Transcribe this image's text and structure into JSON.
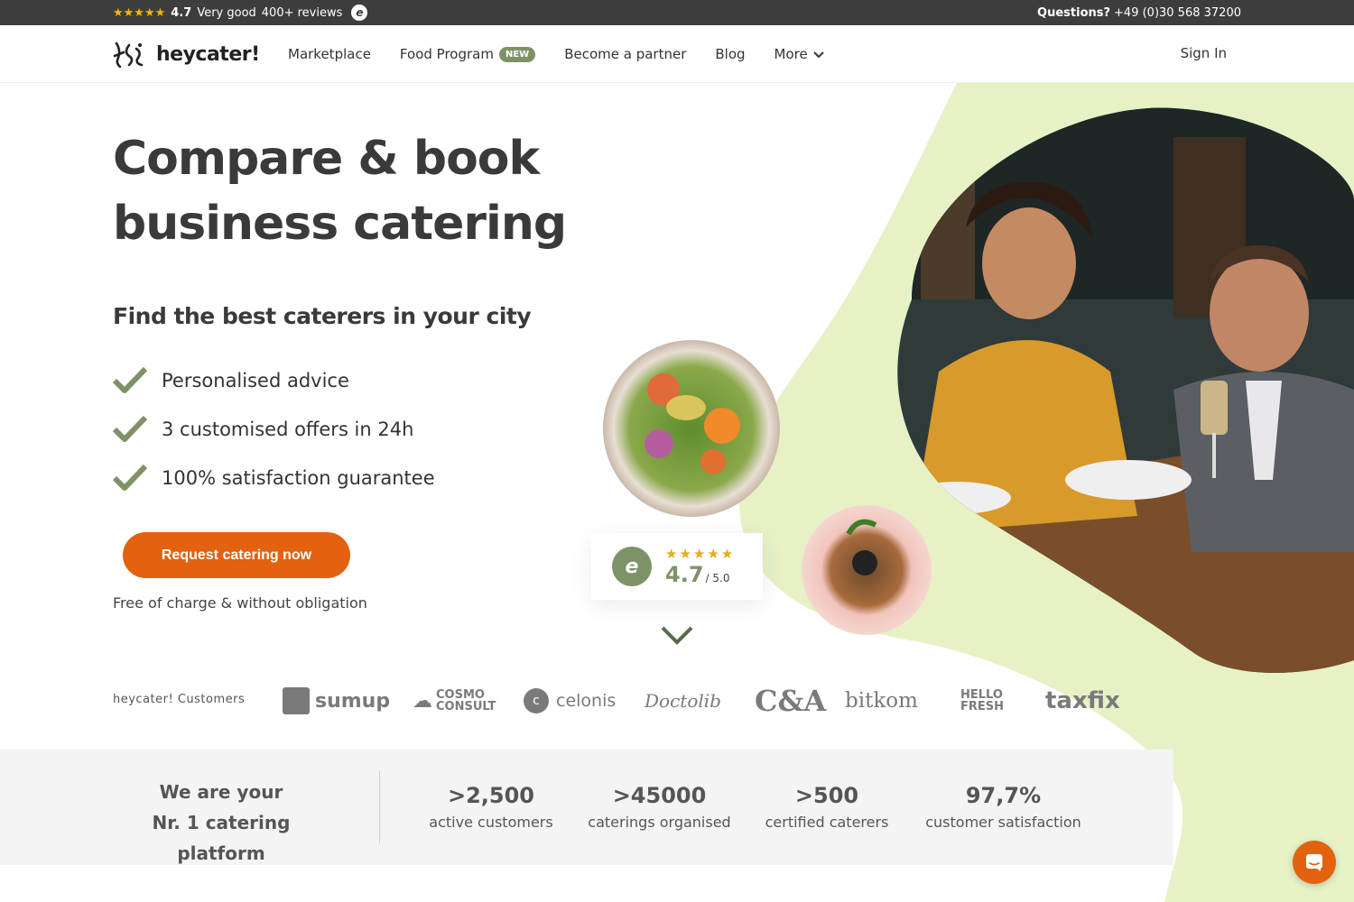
{
  "topbar": {
    "stars": "★★★★★",
    "rating": "4.7",
    "rating_text": "Very good",
    "reviews": "400+ reviews",
    "questions_label": "Questions?",
    "phone": "+49 (0)30 568 37200"
  },
  "nav": {
    "logo_text": "heycater!",
    "items": [
      {
        "label": "Marketplace"
      },
      {
        "label": "Food Program",
        "badge": "NEW"
      },
      {
        "label": "Become a partner"
      },
      {
        "label": "Blog"
      },
      {
        "label": "More"
      }
    ],
    "sign_in": "Sign In"
  },
  "hero": {
    "title_line1": "Compare & book",
    "title_line2": "business catering",
    "subtitle": "Find the best caterers in your city",
    "checks": [
      "Personalised advice",
      "3 customised offers in 24h",
      "100% satisfaction guarantee"
    ],
    "cta": "Request catering now",
    "cta_note": "Free of charge & without obligation"
  },
  "rating_card": {
    "stars": "★★★★★",
    "score": "4.7",
    "max": "/ 5.0"
  },
  "customers": {
    "label": "heycater! Customers",
    "logos": [
      "sumup",
      "COSMO CONSULT",
      "celonis",
      "Doctolib",
      "C&A",
      "bitkom",
      "HELLO FRESH",
      "taxfix"
    ]
  },
  "stats": {
    "title_line1": "We are your",
    "title_line2": "Nr. 1 catering platform",
    "items": [
      {
        "num": ">2,500",
        "label": "active customers"
      },
      {
        "num": ">45000",
        "label": "caterings organised"
      },
      {
        "num": ">500",
        "label": "certified caterers"
      },
      {
        "num": "97,7%",
        "label": "customer satisfaction"
      }
    ]
  },
  "colors": {
    "accent": "#e2620f",
    "green": "#7e9267",
    "lime_bg": "#e6f2c6",
    "dark_bar": "#3d3d3d"
  }
}
